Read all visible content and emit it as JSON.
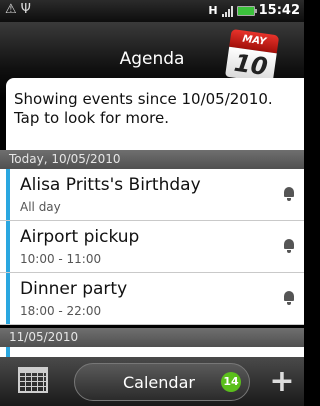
{
  "status_bar": {
    "left_icons": [
      "warning-icon",
      "usb-icon"
    ],
    "network": "H",
    "time": "15:42",
    "battery_color": "#3cc23c"
  },
  "header": {
    "title": "Agenda",
    "calendar_icon": {
      "month": "MAY",
      "day": "10"
    }
  },
  "info_message": {
    "line1": "Showing events since 10/05/2010.",
    "line2": "Tap to look for more."
  },
  "sections": [
    {
      "header": "Today, 10/05/2010",
      "events": [
        {
          "title": "Alisa Pritts's Birthday",
          "time": "All day",
          "color": "#2aa7e0",
          "icon": "bell-icon"
        },
        {
          "title": "Airport pickup",
          "time": "10:00 - 11:00",
          "color": "#2aa7e0",
          "icon": "bell-icon"
        },
        {
          "title": "Dinner party",
          "time": "18:00 - 22:00",
          "color": "#2aa7e0",
          "icon": "bell-icon"
        }
      ]
    },
    {
      "header": "11/05/2010"
    }
  ],
  "bottom_bar": {
    "view_icon": "calendar-grid-icon",
    "tab_label": "Calendar",
    "badge_count": "14",
    "add_icon": "plus-icon"
  }
}
